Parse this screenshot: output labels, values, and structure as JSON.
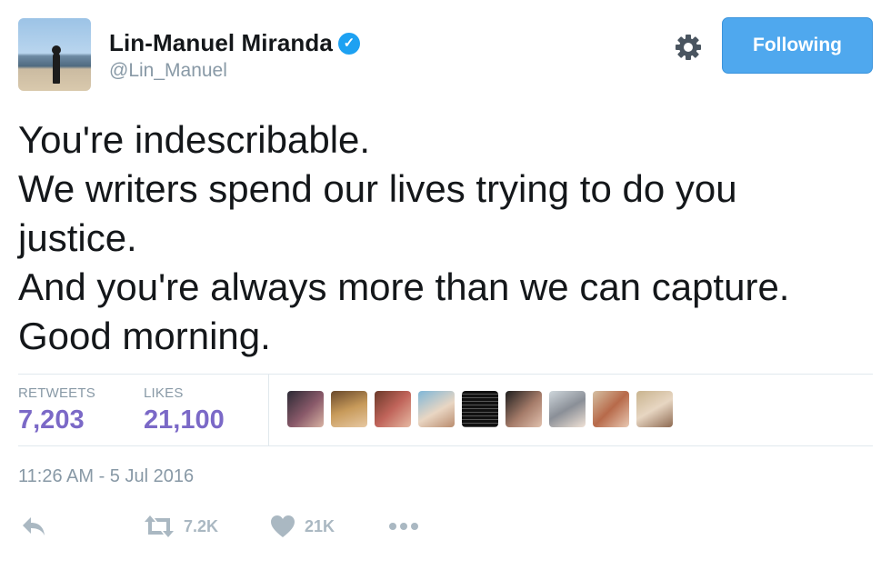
{
  "tweet": {
    "author": {
      "name": "Lin-Manuel Miranda",
      "handle": "@Lin_Manuel",
      "verified_icon": "verified-badge-icon"
    },
    "follow_button_label": "Following",
    "text_lines": [
      "You're indescribable.",
      "We writers spend our lives trying to do you",
      "justice.",
      "And you're always more than we can capture.",
      "Good morning."
    ],
    "stats": {
      "retweets_label": "RETWEETS",
      "retweets_value": "7,203",
      "likes_label": "LIKES",
      "likes_value": "21,100"
    },
    "liker_avatars_count": 9,
    "timestamp": "11:26 AM - 5 Jul 2016",
    "actions": {
      "reply_icon": "reply-icon",
      "retweet_icon": "retweet-icon",
      "retweet_count": "7.2K",
      "like_icon": "heart-icon",
      "like_count": "21K",
      "more_icon": "more-dots-icon"
    }
  },
  "colors": {
    "follow_button": "#4fa8ee",
    "stat_value": "#7b69c7",
    "muted": "#8899a6",
    "action_gray": "#aab8c2",
    "verified": "#1da1f2"
  }
}
